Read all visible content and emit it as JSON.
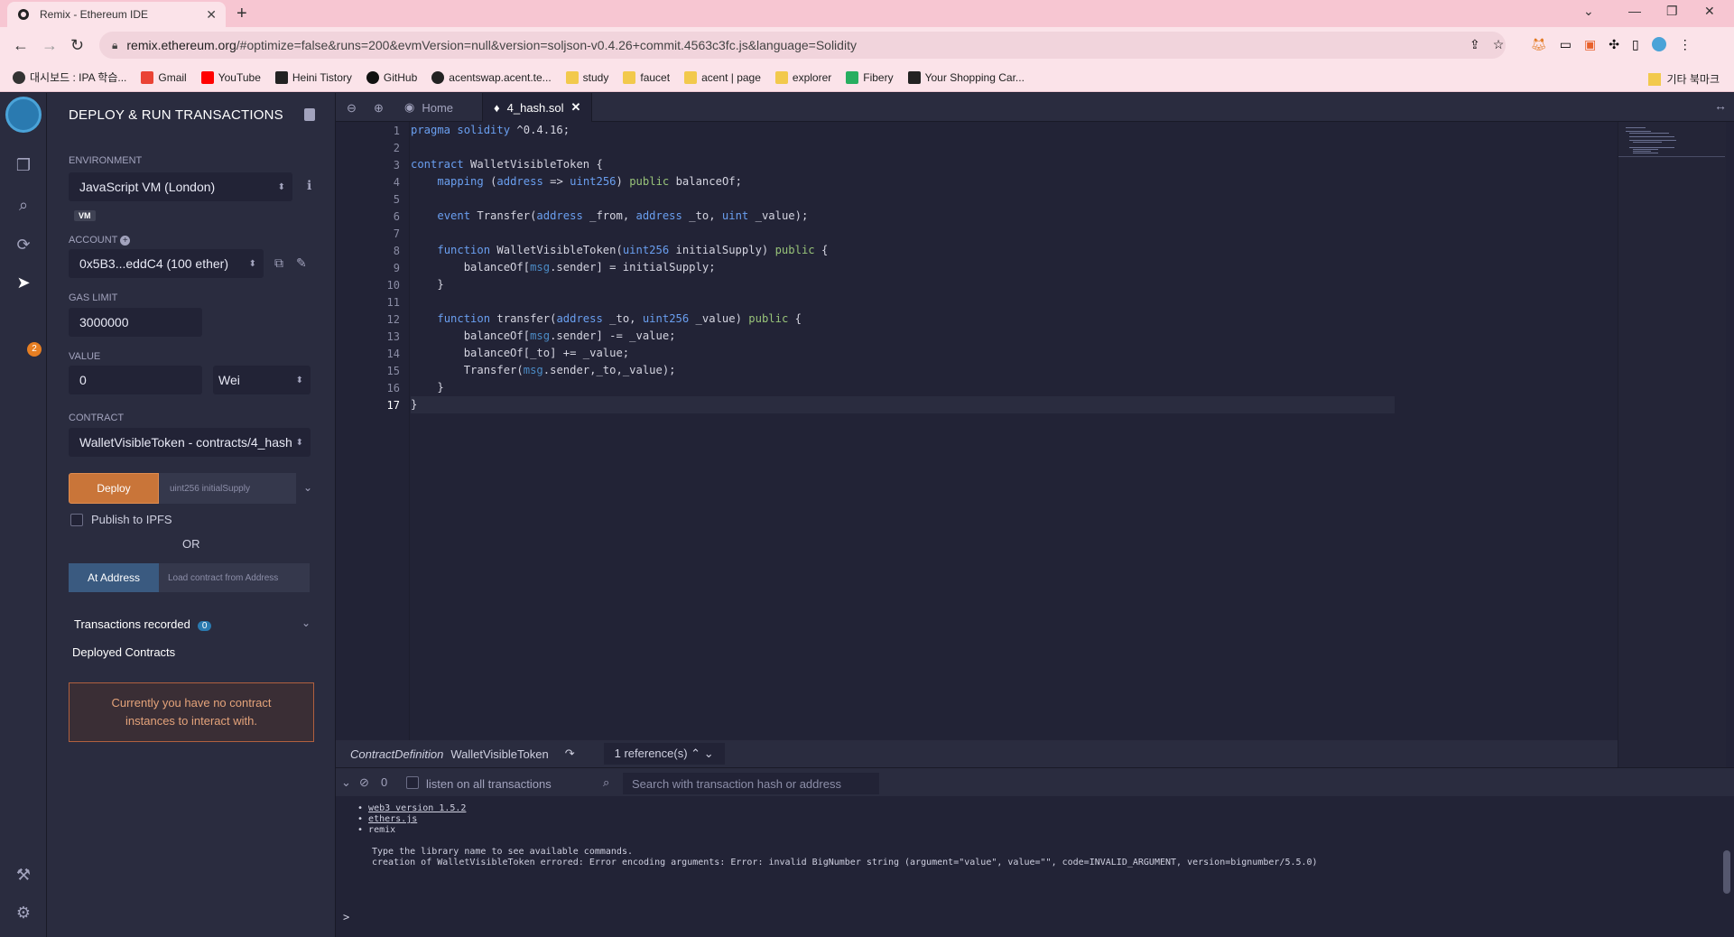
{
  "browser": {
    "tab_title": "Remix - Ethereum IDE",
    "tab_close": "✕",
    "new_tab": "+",
    "url_host": "remix.ethereum.org",
    "url_rest": "/#optimize=false&runs=200&evmVersion=null&version=soljson-v0.4.26+commit.4563c3fc.js&language=Solidity",
    "bookmarks": [
      {
        "label": "대시보드 : IPA 학습...",
        "color": "#333333"
      },
      {
        "label": "Gmail",
        "color": "#ea4335"
      },
      {
        "label": "YouTube",
        "color": "#ff0000"
      },
      {
        "label": "Heini Tistory",
        "color": "#222222"
      },
      {
        "label": "GitHub",
        "color": "#111111"
      },
      {
        "label": "acentswap.acent.te...",
        "color": "#222222"
      },
      {
        "label": "study",
        "color": "#f2c94c"
      },
      {
        "label": "faucet",
        "color": "#f2c94c"
      },
      {
        "label": "acent | page",
        "color": "#f2c94c"
      },
      {
        "label": "explorer",
        "color": "#f2c94c"
      },
      {
        "label": "Fibery",
        "color": "#27ae60"
      },
      {
        "label": "Your Shopping Car...",
        "color": "#222222"
      }
    ],
    "other_bookmarks": "기타 북마크"
  },
  "iconbar": {
    "badge": "2"
  },
  "sidepanel": {
    "title": "DEPLOY & RUN TRANSACTIONS",
    "environment_label": "ENVIRONMENT",
    "environment_value": "JavaScript VM (London)",
    "vm_tag": "VM",
    "account_label": "ACCOUNT",
    "account_value": "0x5B3...eddC4 (100 ether)",
    "gas_limit_label": "GAS LIMIT",
    "gas_limit_value": "3000000",
    "value_label": "VALUE",
    "value_amount": "0",
    "value_unit": "Wei",
    "contract_label": "CONTRACT",
    "contract_value": "WalletVisibleToken - contracts/4_hash",
    "deploy_label": "Deploy",
    "deploy_placeholder": "uint256 initialSupply",
    "publish_label": "Publish to IPFS",
    "or_label": "OR",
    "at_address_label": "At Address",
    "at_address_placeholder": "Load contract from Address",
    "transactions_recorded_label": "Transactions recorded",
    "transactions_recorded_count": "0",
    "deployed_contracts_label": "Deployed Contracts",
    "no_instances_msg": "Currently you have no contract instances to interact with."
  },
  "editor": {
    "tabs": [
      {
        "label": "Home"
      },
      {
        "label": "4_hash.sol"
      }
    ],
    "line_numbers": [
      "1",
      "2",
      "3",
      "4",
      "5",
      "6",
      "7",
      "8",
      "9",
      "10",
      "11",
      "12",
      "13",
      "14",
      "15",
      "16",
      "17"
    ],
    "reference_definition": "ContractDefinition",
    "reference_name": "WalletVisibleToken",
    "reference_count": "1 reference(s)"
  },
  "terminal": {
    "count": "0",
    "listen_label": "listen on all transactions",
    "search_placeholder": "Search with transaction hash or address",
    "lines": [
      "web3 version 1.5.2",
      "ethers.js",
      "remix",
      "Type the library name to see available commands.",
      "creation of WalletVisibleToken errored: Error encoding arguments: Error: invalid BigNumber string (argument=\"value\", value=\"\", code=INVALID_ARGUMENT, version=bignumber/5.5.0)"
    ],
    "prompt": ">"
  },
  "colors": {
    "bg": "#222336",
    "panel": "#2a2c3f",
    "deploy": "#c97539",
    "at_address": "#3a5a80",
    "keyword": "#6a9ff0",
    "modifier": "#98c379"
  }
}
